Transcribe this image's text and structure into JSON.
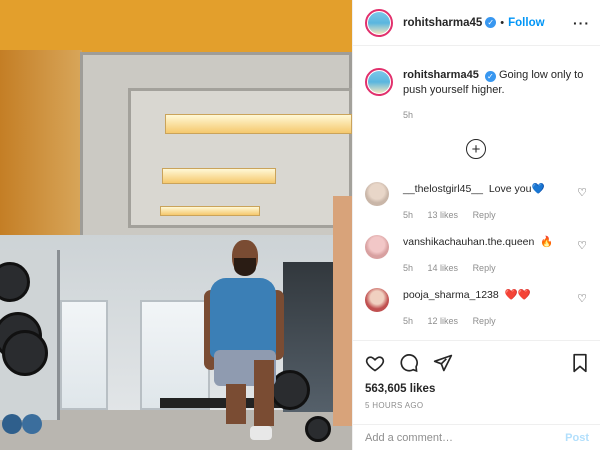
{
  "post": {
    "username": "rohitsharma45",
    "follow_label": "Follow",
    "dot": "•",
    "more": "···",
    "caption_text": "Going low only to push yourself higher.",
    "caption_time": "5h",
    "likes": "563,605 likes",
    "posted_ago": "5 HOURS AGO",
    "comment_placeholder": "Add a comment…",
    "post_label": "Post"
  },
  "comments": [
    {
      "username": "__thelostgirl45__",
      "text": "Love you💙",
      "time": "5h",
      "likes": "13 likes",
      "reply": "Reply"
    },
    {
      "username": "vanshikachauhan.the.queen",
      "text": "🔥",
      "time": "5h",
      "likes": "14 likes",
      "reply": "Reply"
    },
    {
      "username": "pooja_sharma_1238",
      "text": "❤️❤️",
      "time": "5h",
      "likes": "12 likes",
      "reply": "Reply"
    }
  ],
  "colors": {
    "accent": "#0095f6",
    "verified": "#3897f0",
    "muted": "#8e8e8e",
    "post_disabled": "#b2dffc"
  },
  "icons": [
    "verified-icon",
    "more-options-icon",
    "load-more-icon",
    "heart-icon",
    "comment-icon",
    "share-icon",
    "bookmark-icon"
  ]
}
